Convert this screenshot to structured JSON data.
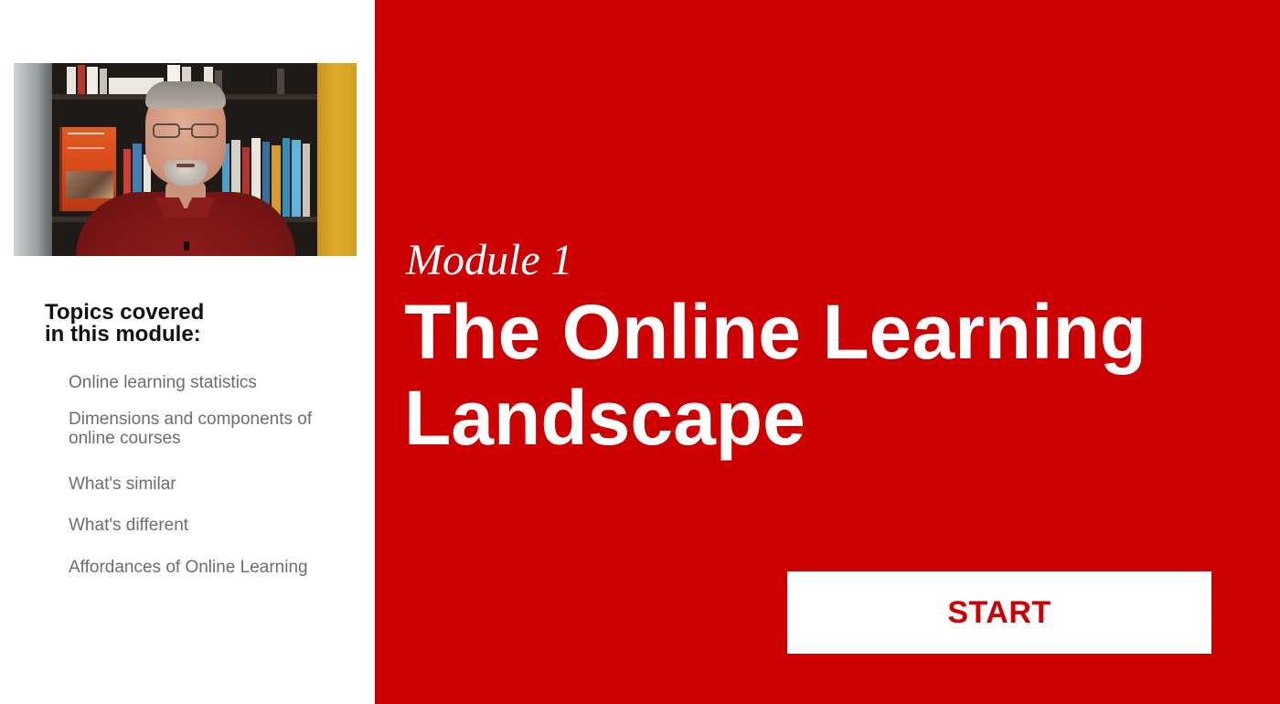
{
  "video": {
    "description_icon": "presenter-video-icon"
  },
  "sidebar": {
    "heading_line1": "Topics covered",
    "heading_line2": "in this module:",
    "topics": [
      "Online learning statistics",
      "Dimensions and components of online courses",
      "What's similar",
      "What's different",
      "Affordances of Online Learning"
    ]
  },
  "main": {
    "module_label": "Module 1",
    "title": "The Online Learning Landscape",
    "start_label": "START"
  },
  "colors": {
    "accent": "#cc0000",
    "background": "#ffffff",
    "heading": "#111111",
    "topic_text": "#6d6d6d"
  }
}
